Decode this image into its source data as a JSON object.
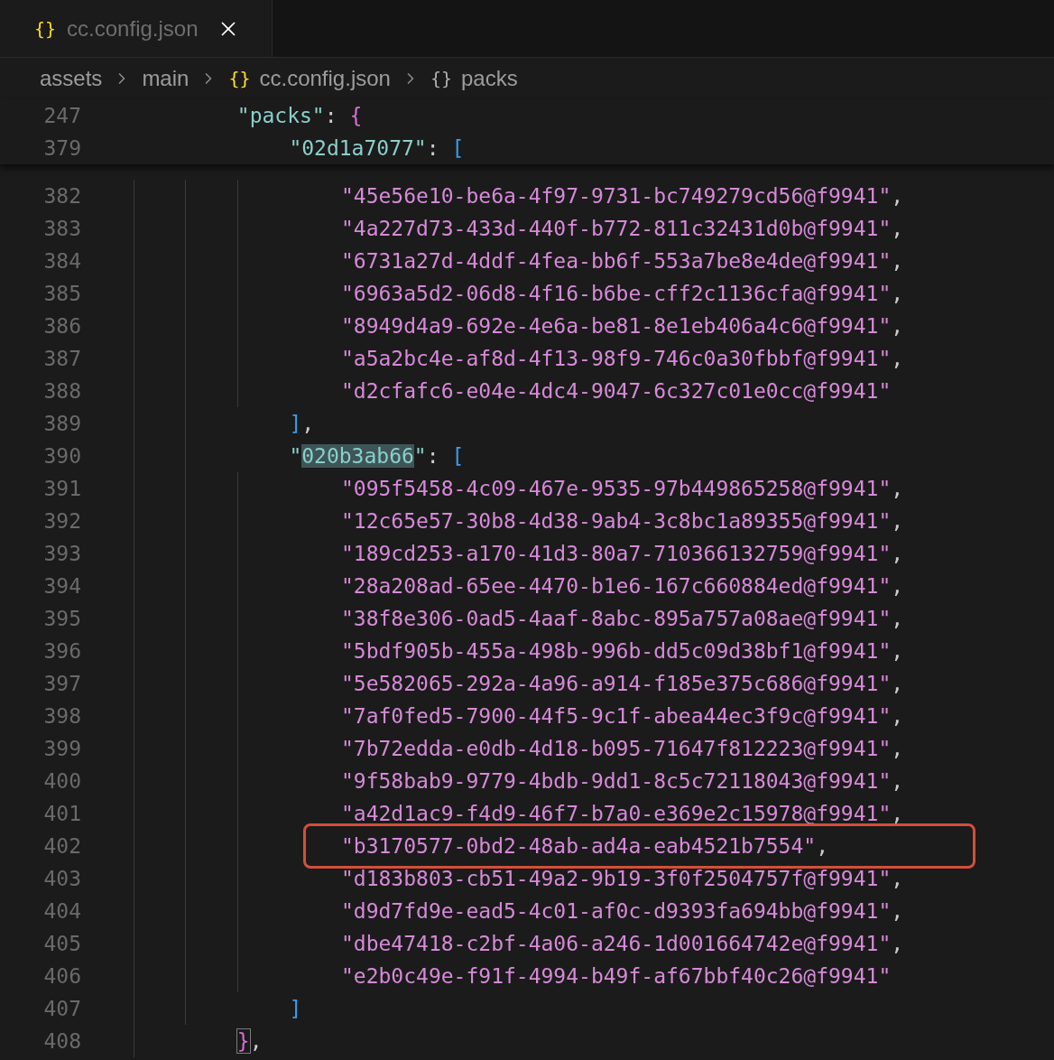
{
  "tab": {
    "icon": "{}",
    "label": "cc.config.json"
  },
  "breadcrumbs": [
    {
      "label": "assets"
    },
    {
      "label": "main"
    },
    {
      "icon": "{}",
      "kind": "file",
      "label": "cc.config.json"
    },
    {
      "icon": "{}",
      "kind": "object",
      "label": "packs"
    }
  ],
  "code": [
    {
      "number": "247",
      "sticky": true,
      "annotated": false,
      "tokens": [
        {
          "kind": "key",
          "text": "\"packs\""
        },
        {
          "kind": "punct",
          "text": ": "
        },
        {
          "kind": "brace",
          "text": "{"
        }
      ],
      "children": [
        {
          "number": "379",
          "sticky": true,
          "annotated": false,
          "tokens": [
            {
              "kind": "key",
              "text": "\"02d1a7077\""
            },
            {
              "kind": "punct",
              "text": ": "
            },
            {
              "kind": "bracket",
              "text": "["
            }
          ],
          "children": [
            {
              "number": "382",
              "sticky": false,
              "annotated": false,
              "tokens": [
                {
                  "kind": "string",
                  "text": "\"45e56e10-be6a-4f97-9731-bc749279cd56@f9941\""
                },
                {
                  "kind": "punct",
                  "text": ","
                }
              ]
            },
            {
              "number": "383",
              "sticky": false,
              "annotated": false,
              "tokens": [
                {
                  "kind": "string",
                  "text": "\"4a227d73-433d-440f-b772-811c32431d0b@f9941\""
                },
                {
                  "kind": "punct",
                  "text": ","
                }
              ]
            },
            {
              "number": "384",
              "sticky": false,
              "annotated": false,
              "tokens": [
                {
                  "kind": "string",
                  "text": "\"6731a27d-4ddf-4fea-bb6f-553a7be8e4de@f9941\""
                },
                {
                  "kind": "punct",
                  "text": ","
                }
              ]
            },
            {
              "number": "385",
              "sticky": false,
              "annotated": false,
              "tokens": [
                {
                  "kind": "string",
                  "text": "\"6963a5d2-06d8-4f16-b6be-cff2c1136cfa@f9941\""
                },
                {
                  "kind": "punct",
                  "text": ","
                }
              ]
            },
            {
              "number": "386",
              "sticky": false,
              "annotated": false,
              "tokens": [
                {
                  "kind": "string",
                  "text": "\"8949d4a9-692e-4e6a-be81-8e1eb406a4c6@f9941\""
                },
                {
                  "kind": "punct",
                  "text": ","
                }
              ]
            },
            {
              "number": "387",
              "sticky": false,
              "annotated": false,
              "tokens": [
                {
                  "kind": "string",
                  "text": "\"a5a2bc4e-af8d-4f13-98f9-746c0a30fbbf@f9941\""
                },
                {
                  "kind": "punct",
                  "text": ","
                }
              ]
            },
            {
              "number": "388",
              "sticky": false,
              "annotated": false,
              "tokens": [
                {
                  "kind": "string",
                  "text": "\"d2cfafc6-e04e-4dc4-9047-6c327c01e0cc@f9941\""
                }
              ]
            }
          ]
        },
        {
          "number": "389",
          "sticky": false,
          "annotated": false,
          "tokens": [
            {
              "kind": "bracket",
              "text": "]"
            },
            {
              "kind": "punct",
              "text": ","
            }
          ]
        },
        {
          "number": "390",
          "sticky": false,
          "annotated": false,
          "tokens": [
            {
              "kind": "key",
              "text": "\""
            },
            {
              "kind": "selection",
              "text": "020b3ab66"
            },
            {
              "kind": "key",
              "text": "\""
            },
            {
              "kind": "punct",
              "text": ": "
            },
            {
              "kind": "bracket",
              "text": "["
            }
          ],
          "children": [
            {
              "number": "391",
              "sticky": false,
              "annotated": false,
              "tokens": [
                {
                  "kind": "string",
                  "text": "\"095f5458-4c09-467e-9535-97b449865258@f9941\""
                },
                {
                  "kind": "punct",
                  "text": ","
                }
              ]
            },
            {
              "number": "392",
              "sticky": false,
              "annotated": false,
              "tokens": [
                {
                  "kind": "string",
                  "text": "\"12c65e57-30b8-4d38-9ab4-3c8bc1a89355@f9941\""
                },
                {
                  "kind": "punct",
                  "text": ","
                }
              ]
            },
            {
              "number": "393",
              "sticky": false,
              "annotated": false,
              "tokens": [
                {
                  "kind": "string",
                  "text": "\"189cd253-a170-41d3-80a7-710366132759@f9941\""
                },
                {
                  "kind": "punct",
                  "text": ","
                }
              ]
            },
            {
              "number": "394",
              "sticky": false,
              "annotated": false,
              "tokens": [
                {
                  "kind": "string",
                  "text": "\"28a208ad-65ee-4470-b1e6-167c660884ed@f9941\""
                },
                {
                  "kind": "punct",
                  "text": ","
                }
              ]
            },
            {
              "number": "395",
              "sticky": false,
              "annotated": false,
              "tokens": [
                {
                  "kind": "string",
                  "text": "\"38f8e306-0ad5-4aaf-8abc-895a757a08ae@f9941\""
                },
                {
                  "kind": "punct",
                  "text": ","
                }
              ]
            },
            {
              "number": "396",
              "sticky": false,
              "annotated": false,
              "tokens": [
                {
                  "kind": "string",
                  "text": "\"5bdf905b-455a-498b-996b-dd5c09d38bf1@f9941\""
                },
                {
                  "kind": "punct",
                  "text": ","
                }
              ]
            },
            {
              "number": "397",
              "sticky": false,
              "annotated": false,
              "tokens": [
                {
                  "kind": "string",
                  "text": "\"5e582065-292a-4a96-a914-f185e375c686@f9941\""
                },
                {
                  "kind": "punct",
                  "text": ","
                }
              ]
            },
            {
              "number": "398",
              "sticky": false,
              "annotated": false,
              "tokens": [
                {
                  "kind": "string",
                  "text": "\"7af0fed5-7900-44f5-9c1f-abea44ec3f9c@f9941\""
                },
                {
                  "kind": "punct",
                  "text": ","
                }
              ]
            },
            {
              "number": "399",
              "sticky": false,
              "annotated": false,
              "tokens": [
                {
                  "kind": "string",
                  "text": "\"7b72edda-e0db-4d18-b095-71647f812223@f9941\""
                },
                {
                  "kind": "punct",
                  "text": ","
                }
              ]
            },
            {
              "number": "400",
              "sticky": false,
              "annotated": false,
              "tokens": [
                {
                  "kind": "string",
                  "text": "\"9f58bab9-9779-4bdb-9dd1-8c5c72118043@f9941\""
                },
                {
                  "kind": "punct",
                  "text": ","
                }
              ]
            },
            {
              "number": "401",
              "sticky": false,
              "annotated": false,
              "tokens": [
                {
                  "kind": "string",
                  "text": "\"a42d1ac9-f4d9-46f7-b7a0-e369e2c15978@f9941\""
                },
                {
                  "kind": "punct",
                  "text": ","
                }
              ]
            },
            {
              "number": "402",
              "sticky": false,
              "annotated": true,
              "tokens": [
                {
                  "kind": "string",
                  "text": "\"b3170577-0bd2-48ab-ad4a-eab4521b7554\""
                },
                {
                  "kind": "punct",
                  "text": ","
                }
              ]
            },
            {
              "number": "403",
              "sticky": false,
              "annotated": false,
              "tokens": [
                {
                  "kind": "string",
                  "text": "\"d183b803-cb51-49a2-9b19-3f0f2504757f@f9941\""
                },
                {
                  "kind": "punct",
                  "text": ","
                }
              ]
            },
            {
              "number": "404",
              "sticky": false,
              "annotated": false,
              "tokens": [
                {
                  "kind": "string",
                  "text": "\"d9d7fd9e-ead5-4c01-af0c-d9393fa694bb@f9941\""
                },
                {
                  "kind": "punct",
                  "text": ","
                }
              ]
            },
            {
              "number": "405",
              "sticky": false,
              "annotated": false,
              "tokens": [
                {
                  "kind": "string",
                  "text": "\"dbe47418-c2bf-4a06-a246-1d001664742e@f9941\""
                },
                {
                  "kind": "punct",
                  "text": ","
                }
              ]
            },
            {
              "number": "406",
              "sticky": false,
              "annotated": false,
              "tokens": [
                {
                  "kind": "string",
                  "text": "\"e2b0c49e-f91f-4994-b49f-af67bbf40c26@f9941\""
                }
              ]
            }
          ]
        },
        {
          "number": "407",
          "sticky": false,
          "annotated": false,
          "tokens": [
            {
              "kind": "bracket",
              "text": "]"
            }
          ]
        }
      ]
    },
    {
      "number": "408",
      "sticky": false,
      "annotated": false,
      "tokens": [
        {
          "kind": "bracket_match",
          "text": "}"
        },
        {
          "kind": "punct",
          "text": ","
        }
      ]
    }
  ]
}
